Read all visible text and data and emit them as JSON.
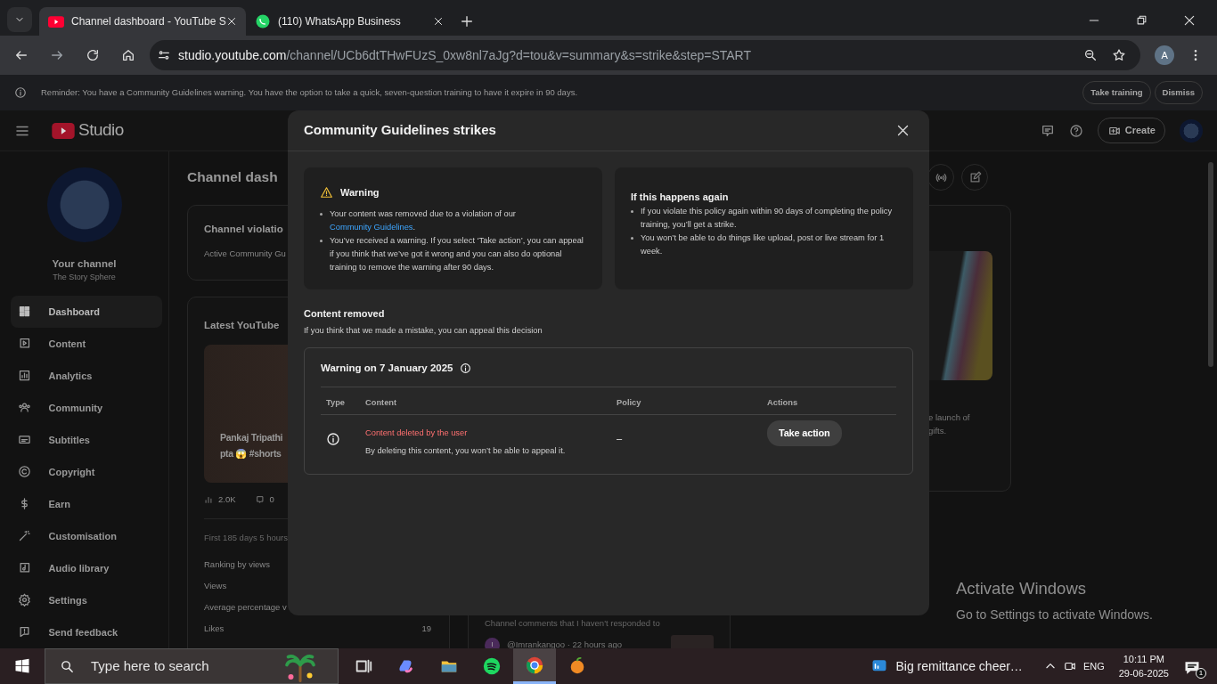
{
  "browser": {
    "tabs": [
      {
        "title": "Channel dashboard - YouTube S",
        "selected": true,
        "kind": "youtube"
      },
      {
        "title": "(110) WhatsApp Business",
        "selected": false,
        "kind": "whatsapp"
      }
    ],
    "url": {
      "host": "studio.youtube.com",
      "path": "/channel/UCb6dtTHwFUzS_0xw8nl7aJg?d=tou&v=summary&s=strike&step=START"
    },
    "profile_initial": "A"
  },
  "banner": {
    "text": "Reminder: You have a Community Guidelines warning. You have the option to take a quick, seven-question training to have it expire in 90 days.",
    "buttons": [
      "Take training",
      "Dismiss"
    ]
  },
  "header": {
    "logo": "Studio",
    "create": "Create"
  },
  "sidebar": {
    "channel_label": "Your channel",
    "channel_name": "The Story Sphere",
    "items": [
      {
        "label": "Dashboard",
        "selected": true
      },
      {
        "label": "Content",
        "selected": false
      },
      {
        "label": "Analytics",
        "selected": false
      },
      {
        "label": "Community",
        "selected": false
      },
      {
        "label": "Subtitles",
        "selected": false
      },
      {
        "label": "Copyright",
        "selected": false
      },
      {
        "label": "Earn",
        "selected": false
      },
      {
        "label": "Customisation",
        "selected": false
      },
      {
        "label": "Audio library",
        "selected": false
      },
      {
        "label": "Settings",
        "selected": false
      },
      {
        "label": "Send feedback",
        "selected": false
      }
    ]
  },
  "dashboard": {
    "title": "Channel dash",
    "violations": {
      "title": "Channel violatio",
      "text": "Active Community Gu"
    },
    "latest": {
      "title": "Latest YouTube",
      "video_title": [
        "Pankaj Tripathi",
        "pta 😱 #shorts"
      ],
      "views": "2.0K",
      "comments": "0",
      "period": "First 185 days 5 hours",
      "metrics": [
        {
          "label": "Ranking by views"
        },
        {
          "label": "Views"
        },
        {
          "label": "Average percentage v"
        },
        {
          "label": "Likes",
          "value": "19"
        }
      ]
    },
    "comments": {
      "title": "Channel comments that I haven't responded to",
      "avatar_initial": "I",
      "author": "@Imrankangoo · 22 hours ago"
    },
    "news": {
      "lines": [
        "e launch of",
        "gifts."
      ]
    }
  },
  "modal": {
    "title": "Community Guidelines strikes",
    "warning": {
      "title": "Warning",
      "bullets": [
        {
          "text": "Your content was removed due to a violation of our ",
          "link": "Community Guidelines",
          "after": "."
        },
        {
          "text": "You’ve received a warning. If you select ‘Take action’, you can appeal if you think that we’ve got it wrong and you can also do optional training to remove the warning after 90 days."
        }
      ]
    },
    "again": {
      "title": "If this happens again",
      "bullets": [
        {
          "text": "If you violate this policy again within 90 days of completing the policy training, you’ll get a strike."
        },
        {
          "text": "You won’t be able to do things like upload, post or live stream for 1 week."
        }
      ]
    },
    "removed": {
      "title": "Content removed",
      "subtitle": "If you think that we made a mistake, you can appeal this decision"
    },
    "strike": {
      "title": "Warning on 7 January 2025",
      "columns": [
        "Type",
        "Content",
        "Policy",
        "Actions"
      ],
      "rows": [
        {
          "content": "Content deleted by the user",
          "note": "By deleting this content, you won’t be able to appeal it.",
          "policy": "–",
          "action": "Take action"
        }
      ]
    }
  },
  "os_notice": {
    "title": "Activate Windows",
    "text": "Go to Settings to activate Windows."
  },
  "taskbar": {
    "search_placeholder": "Type here to search",
    "apps": [
      {
        "kind": "taskview",
        "selected": false
      },
      {
        "kind": "copilot",
        "selected": false
      },
      {
        "kind": "explorer",
        "selected": false
      },
      {
        "kind": "spotify",
        "selected": false
      },
      {
        "kind": "chrome",
        "selected": true
      },
      {
        "kind": "fl",
        "selected": false
      }
    ],
    "news": "Big remittance cheer…",
    "language": "ENG",
    "time": "10:11 PM",
    "date": "29-06-2025",
    "notifications": "1"
  }
}
